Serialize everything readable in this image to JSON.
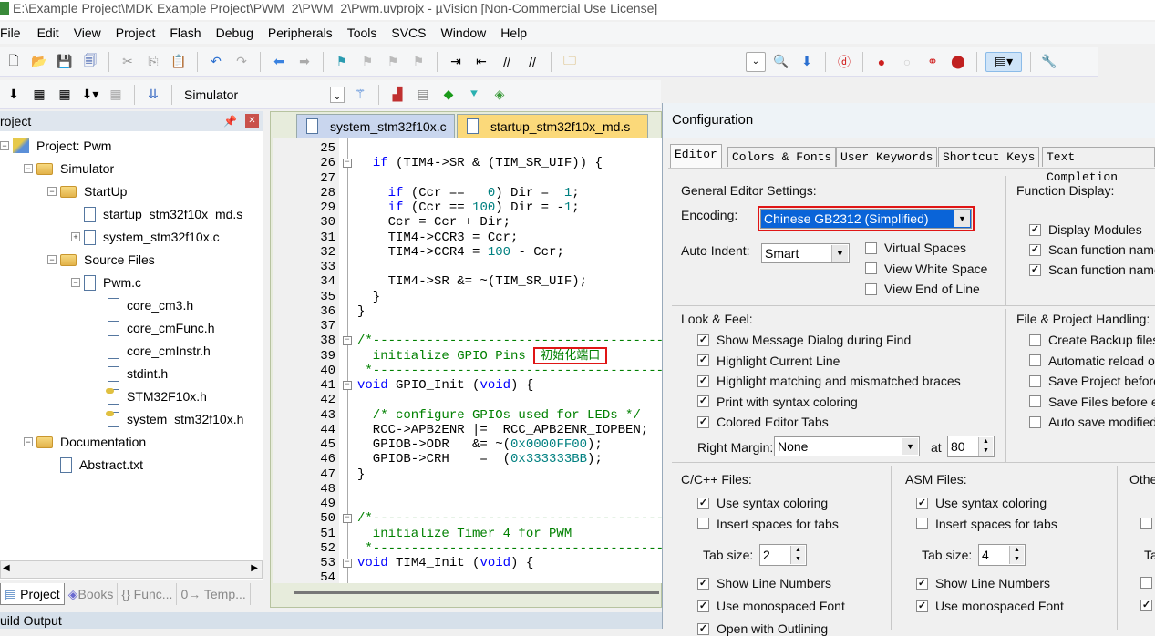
{
  "window": {
    "title": "E:\\Example Project\\MDK Example Project\\PWM_2\\PWM_2\\Pwm.uvprojx - µVision  [Non-Commercial Use License]"
  },
  "menu": [
    "File",
    "Edit",
    "View",
    "Project",
    "Flash",
    "Debug",
    "Peripherals",
    "Tools",
    "SVCS",
    "Window",
    "Help"
  ],
  "toolbar2": {
    "target": "Simulator"
  },
  "project_panel": {
    "title": "roject",
    "tree": [
      {
        "label": "Project: Pwm",
        "level": 0,
        "icon": "project-icon",
        "expander": "-"
      },
      {
        "label": "Simulator",
        "level": 1,
        "icon": "folder-icon",
        "expander": "-"
      },
      {
        "label": "StartUp",
        "level": 2,
        "icon": "folder-icon",
        "expander": "-"
      },
      {
        "label": "startup_stm32f10x_md.s",
        "level": 3,
        "icon": "file-icon",
        "expander": ""
      },
      {
        "label": "system_stm32f10x.c",
        "level": 3,
        "icon": "file-icon",
        "expander": "+"
      },
      {
        "label": "Source Files",
        "level": 2,
        "icon": "folder-icon",
        "expander": "-"
      },
      {
        "label": "Pwm.c",
        "level": 3,
        "icon": "file-icon",
        "expander": "-"
      },
      {
        "label": "core_cm3.h",
        "level": 4,
        "icon": "header-file-icon",
        "expander": ""
      },
      {
        "label": "core_cmFunc.h",
        "level": 4,
        "icon": "header-file-icon",
        "expander": ""
      },
      {
        "label": "core_cmInstr.h",
        "level": 4,
        "icon": "header-file-icon",
        "expander": ""
      },
      {
        "label": "stdint.h",
        "level": 4,
        "icon": "header-file-icon",
        "expander": ""
      },
      {
        "label": "STM32F10x.h",
        "level": 4,
        "icon": "key-header-file-icon",
        "expander": ""
      },
      {
        "label": "system_stm32f10x.h",
        "level": 4,
        "icon": "key-header-file-icon",
        "expander": ""
      },
      {
        "label": "Documentation",
        "level": 1,
        "icon": "folder-icon",
        "expander": "-"
      },
      {
        "label": "Abstract.txt",
        "level": 2,
        "icon": "file-icon",
        "expander": ""
      }
    ],
    "tabs": [
      "Project",
      "Books",
      "{} Func...",
      "0→ Temp..."
    ]
  },
  "editor": {
    "tabs": [
      {
        "label": "system_stm32f10x.c",
        "color": "#c9d6ee"
      },
      {
        "label": "startup_stm32f10x_md.s",
        "color": "#fbd97a"
      }
    ],
    "lines": [
      {
        "n": "25",
        "s": []
      },
      {
        "n": "26",
        "fold": true,
        "s": [
          {
            "t": "  "
          },
          {
            "t": "if",
            "c": "kw"
          },
          {
            "t": " (TIM4->SR & (TIM_SR_UIF)) {"
          }
        ]
      },
      {
        "n": "27",
        "s": []
      },
      {
        "n": "28",
        "s": [
          {
            "t": "    "
          },
          {
            "t": "if",
            "c": "kw"
          },
          {
            "t": " (Ccr ==   "
          },
          {
            "t": "0",
            "c": "num"
          },
          {
            "t": ") Dir =  "
          },
          {
            "t": "1",
            "c": "num"
          },
          {
            "t": ";"
          }
        ]
      },
      {
        "n": "29",
        "s": [
          {
            "t": "    "
          },
          {
            "t": "if",
            "c": "kw"
          },
          {
            "t": " (Ccr == "
          },
          {
            "t": "100",
            "c": "num"
          },
          {
            "t": ") Dir = -"
          },
          {
            "t": "1",
            "c": "num"
          },
          {
            "t": ";"
          }
        ]
      },
      {
        "n": "30",
        "s": [
          {
            "t": "    Ccr = Ccr + Dir;"
          }
        ]
      },
      {
        "n": "31",
        "s": [
          {
            "t": "    TIM4->CCR3 = Ccr;"
          }
        ]
      },
      {
        "n": "32",
        "s": [
          {
            "t": "    TIM4->CCR4 = "
          },
          {
            "t": "100",
            "c": "num"
          },
          {
            "t": " - Ccr;"
          }
        ]
      },
      {
        "n": "33",
        "s": []
      },
      {
        "n": "34",
        "s": [
          {
            "t": "    TIM4->SR &= ~(TIM_SR_UIF);"
          }
        ]
      },
      {
        "n": "35",
        "s": [
          {
            "t": "  }"
          }
        ]
      },
      {
        "n": "36",
        "s": [
          {
            "t": "}"
          }
        ]
      },
      {
        "n": "37",
        "s": []
      },
      {
        "n": "38",
        "fold": true,
        "s": [
          {
            "t": "/*----------------------------------------",
            "c": "cmt"
          }
        ]
      },
      {
        "n": "39",
        "s": [
          {
            "t": "  initialize GPIO Pins ",
            "c": "cmt"
          },
          {
            "t": "初始化端口",
            "c": "cn"
          }
        ]
      },
      {
        "n": "40",
        "s": [
          {
            "t": " *---------------------------------------",
            "c": "cmt"
          }
        ]
      },
      {
        "n": "41",
        "fold": true,
        "s": [
          {
            "t": "void",
            "c": "kw"
          },
          {
            "t": " GPIO_Init ("
          },
          {
            "t": "void",
            "c": "kw"
          },
          {
            "t": ") {"
          }
        ]
      },
      {
        "n": "42",
        "s": []
      },
      {
        "n": "43",
        "s": [
          {
            "t": "  /* configure GPIOs used for LEDs */",
            "c": "cmt"
          }
        ]
      },
      {
        "n": "44",
        "s": [
          {
            "t": "  RCC->APB2ENR |=  RCC_APB2ENR_IOPBEN;"
          }
        ]
      },
      {
        "n": "45",
        "s": [
          {
            "t": "  GPIOB->ODR   &= ~("
          },
          {
            "t": "0x0000FF00",
            "c": "num"
          },
          {
            "t": ");"
          }
        ]
      },
      {
        "n": "46",
        "s": [
          {
            "t": "  GPIOB->CRH    =  ("
          },
          {
            "t": "0x333333BB",
            "c": "num"
          },
          {
            "t": ");"
          }
        ]
      },
      {
        "n": "47",
        "s": [
          {
            "t": "}"
          }
        ]
      },
      {
        "n": "48",
        "s": []
      },
      {
        "n": "49",
        "s": []
      },
      {
        "n": "50",
        "fold": true,
        "s": [
          {
            "t": "/*----------------------------------------",
            "c": "cmt"
          }
        ]
      },
      {
        "n": "51",
        "s": [
          {
            "t": "  initialize Timer 4 for PWM",
            "c": "cmt"
          }
        ]
      },
      {
        "n": "52",
        "s": [
          {
            "t": " *---------------------------------------",
            "c": "cmt"
          }
        ]
      },
      {
        "n": "53",
        "fold": true,
        "s": [
          {
            "t": "void",
            "c": "kw"
          },
          {
            "t": " TIM4_Init ("
          },
          {
            "t": "void",
            "c": "kw"
          },
          {
            "t": ") {"
          }
        ]
      },
      {
        "n": "54",
        "s": []
      }
    ]
  },
  "build_output": {
    "title": "uild Output"
  },
  "config": {
    "title": "Configuration",
    "tabs": [
      "Editor",
      "Colors & Fonts",
      "User Keywords",
      "Shortcut Keys",
      "Text Completion"
    ],
    "general": {
      "heading": "General Editor Settings:",
      "encoding_label": "Encoding:",
      "encoding_value": "Chinese GB2312 (Simplified)",
      "auto_indent_label": "Auto Indent:",
      "auto_indent_value": "Smart",
      "options": [
        {
          "label": "Virtual Spaces",
          "checked": false
        },
        {
          "label": "View White Space",
          "checked": false
        },
        {
          "label": "View End of Line",
          "checked": false
        }
      ]
    },
    "function_display": {
      "heading": "Function Display:",
      "options": [
        {
          "label": "Display Modules",
          "checked": true
        },
        {
          "label": "Scan function name",
          "checked": true
        },
        {
          "label": "Scan function name",
          "checked": true
        }
      ]
    },
    "look_feel": {
      "heading": "Look & Feel:",
      "options": [
        {
          "label": "Show Message Dialog during Find",
          "checked": true
        },
        {
          "label": "Highlight Current Line",
          "checked": true
        },
        {
          "label": "Highlight matching and mismatched braces",
          "checked": true
        },
        {
          "label": "Print with syntax coloring",
          "checked": true
        },
        {
          "label": "Colored Editor Tabs",
          "checked": true
        }
      ],
      "right_margin_label": "Right Margin:",
      "right_margin_value": "None",
      "at_label": "at",
      "at_value": "80"
    },
    "file_project": {
      "heading": "File & Project Handling:",
      "options": [
        {
          "label": "Create Backup files",
          "checked": false
        },
        {
          "label": "Automatic reload of",
          "checked": false
        },
        {
          "label": "Save Project before",
          "checked": false
        },
        {
          "label": "Save Files before er",
          "checked": false
        },
        {
          "label": "Auto save modified",
          "checked": false
        }
      ]
    },
    "c_files": {
      "heading": "C/C++ Files:",
      "options": [
        {
          "label": "Use syntax coloring",
          "checked": true
        },
        {
          "label": "Insert spaces for tabs",
          "checked": false
        }
      ],
      "tab_size_label": "Tab size:",
      "tab_size": "2",
      "options2": [
        {
          "label": "Show Line Numbers",
          "checked": true
        },
        {
          "label": "Use monospaced Font",
          "checked": true
        },
        {
          "label": "Open with Outlining",
          "checked": true
        }
      ]
    },
    "asm_files": {
      "heading": "ASM Files:",
      "options": [
        {
          "label": "Use syntax coloring",
          "checked": true
        },
        {
          "label": "Insert spaces for tabs",
          "checked": false
        }
      ],
      "tab_size_label": "Tab size:",
      "tab_size": "4",
      "options2": [
        {
          "label": "Show Line Numbers",
          "checked": true
        },
        {
          "label": "Use monospaced Font",
          "checked": true
        }
      ]
    },
    "other_files": {
      "heading": "Othe",
      "tab_size_label": "Ta",
      "checks": [
        false,
        false,
        true
      ]
    }
  },
  "colors": {
    "highlight_red": "#e01515",
    "selection_blue": "#0a64d8",
    "keyword": "#0000ff",
    "number": "#008080",
    "comment": "#008000"
  }
}
